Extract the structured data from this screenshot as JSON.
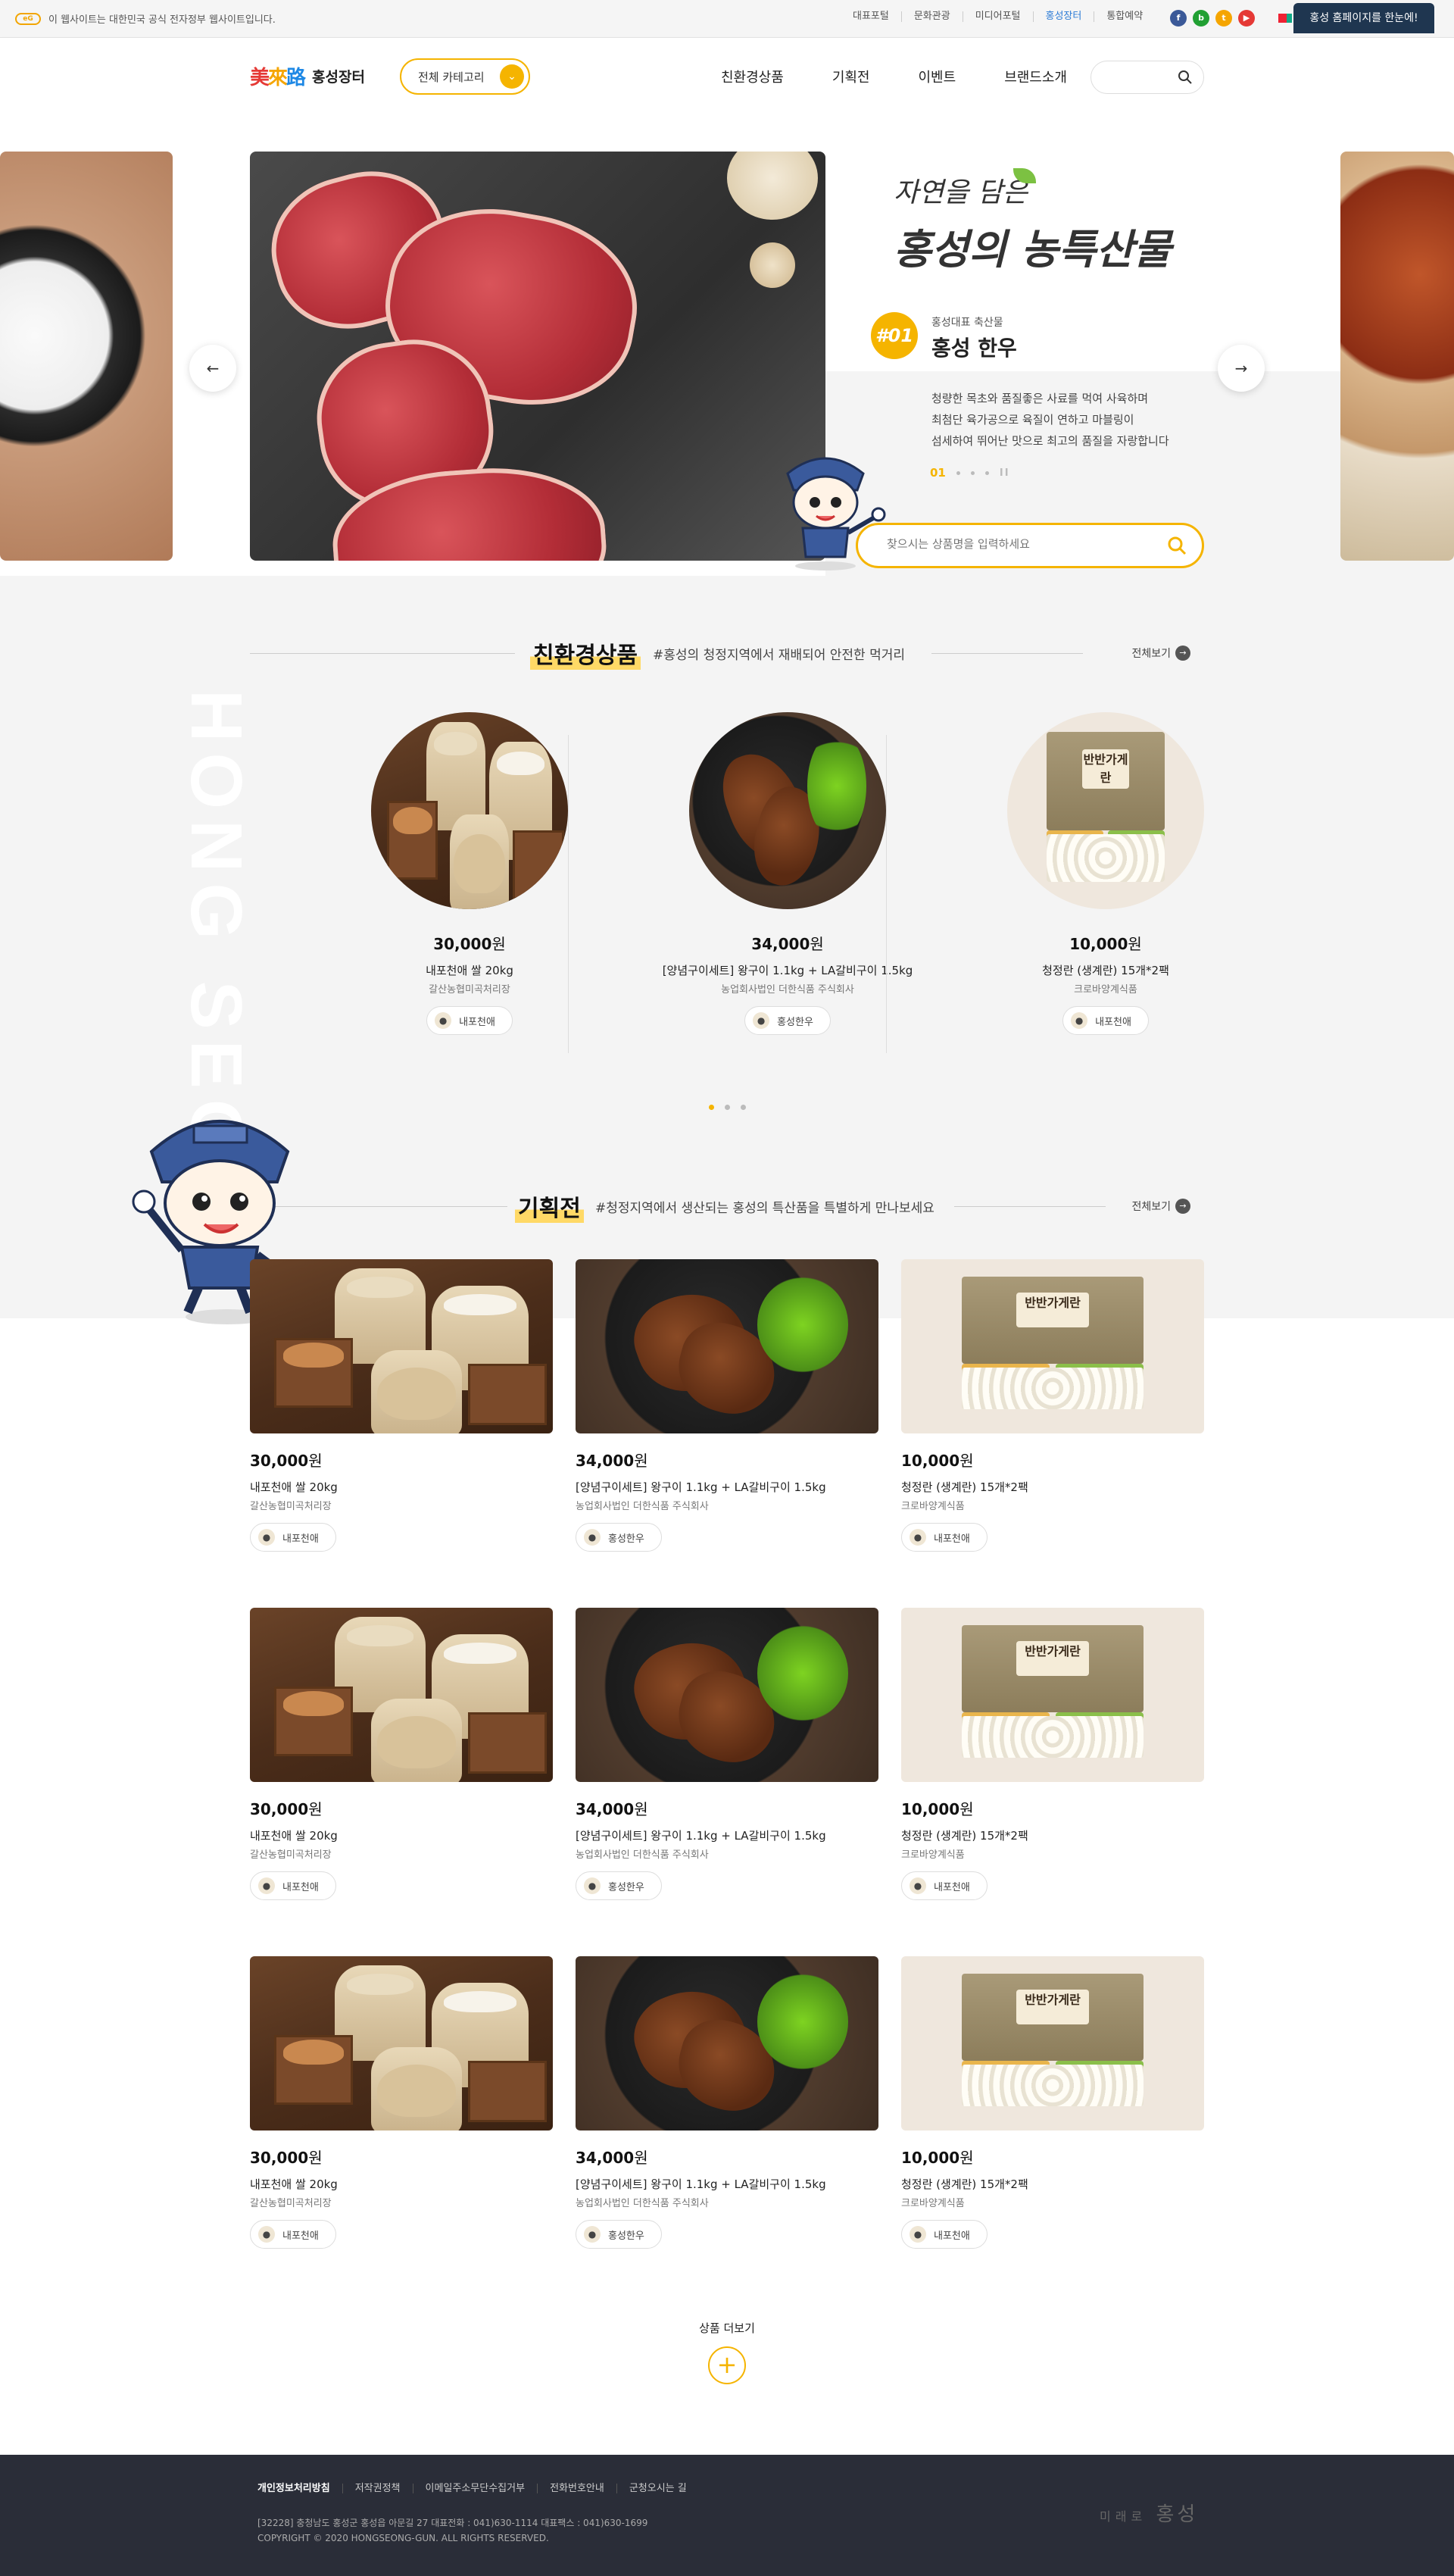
{
  "topbar": {
    "notice": "이 웹사이트는 대한민국 공식 전자정부 웹사이트입니다.",
    "eg_logo": "eG",
    "links": [
      "대표포털",
      "문화관광",
      "미디어포털",
      "홍성장터",
      "통합예약"
    ],
    "active_link": "홍성장터",
    "sns": [
      {
        "icon": "facebook-icon",
        "glyph": "f",
        "color": "#3b5998"
      },
      {
        "icon": "blog-icon",
        "glyph": "b",
        "color": "#21a033"
      },
      {
        "icon": "talk-icon",
        "glyph": "t",
        "color": "#f5a500"
      },
      {
        "icon": "youtube-icon",
        "glyph": "▶",
        "color": "#e53935"
      }
    ],
    "home_button": "홍성 홈페이지를 한눈에!"
  },
  "header": {
    "logo_mark": [
      "美",
      "來",
      "路"
    ],
    "logo_name": "홍성장터",
    "category_button": "전체 카테고리",
    "nav": [
      "친환경상품",
      "기획전",
      "이벤트",
      "브랜드소개"
    ],
    "search_placeholder": ""
  },
  "hero": {
    "slogan_line1": "자연을 담은",
    "slogan_line2": "홍성의 농특산물",
    "number": "#01",
    "category": "홍성대표 축산물",
    "title": "홍성 한우",
    "desc_lines": [
      "청량한 목초와 품질좋은 사료를 먹여 사육하며",
      "최첨단 육가공으로 육질이 연하고 마블링이",
      "섬세하여 뛰어난 맛으로 최고의 품질을 자랑합니다"
    ],
    "page_current": "01",
    "pause_icon": "II",
    "prev_icon": "←",
    "next_icon": "→",
    "search_placeholder": "찾으시는 상품명을 입력하세요"
  },
  "eco": {
    "title": "친환경상품",
    "subtitle": "#홍성의 청정지역에서 재배되어 안전한 먹거리",
    "more": "전체보기",
    "vertical_text": "HONG SEONG",
    "items": [
      {
        "price": "30,000",
        "won": "원",
        "name": "내포천애 쌀 20kg",
        "seller": "갈산농협미곡처리장",
        "tag": "내포천애",
        "art": "rice"
      },
      {
        "price": "34,000",
        "won": "원",
        "name": "[양념구이세트] 왕구이 1.1kg + LA갈비구이 1.5kg",
        "seller": "농업회사법인 더한식품 주식회사",
        "tag": "홍성한우",
        "art": "rib"
      },
      {
        "price": "10,000",
        "won": "원",
        "name": "청정란 (생계란) 15개*2팩",
        "seller": "크로바양계식품",
        "tag": "내포천애",
        "art": "egg"
      }
    ],
    "page_dots": 3,
    "active_dot": 0
  },
  "plan": {
    "title": "기획전",
    "subtitle": "#청정지역에서 생산되는 홍성의 특산품을 특별하게 만나보세요",
    "more": "전체보기",
    "rows": [
      [
        {
          "price": "30,000",
          "won": "원",
          "name": "내포천애 쌀 20kg",
          "seller": "갈산농협미곡처리장",
          "tag": "내포천애",
          "art": "rice"
        },
        {
          "price": "34,000",
          "won": "원",
          "name": "[양념구이세트] 왕구이 1.1kg + LA갈비구이 1.5kg",
          "seller": "농업회사법인 더한식품 주식회사",
          "tag": "홍성한우",
          "art": "rib"
        },
        {
          "price": "10,000",
          "won": "원",
          "name": "청정란 (생계란) 15개*2팩",
          "seller": "크로바양계식품",
          "tag": "내포천애",
          "art": "egg"
        }
      ],
      [
        {
          "price": "30,000",
          "won": "원",
          "name": "내포천애 쌀 20kg",
          "seller": "갈산농협미곡처리장",
          "tag": "내포천애",
          "art": "rice"
        },
        {
          "price": "34,000",
          "won": "원",
          "name": "[양념구이세트] 왕구이 1.1kg + LA갈비구이 1.5kg",
          "seller": "농업회사법인 더한식품 주식회사",
          "tag": "홍성한우",
          "art": "rib"
        },
        {
          "price": "10,000",
          "won": "원",
          "name": "청정란 (생계란) 15개*2팩",
          "seller": "크로바양계식품",
          "tag": "내포천애",
          "art": "egg"
        }
      ],
      [
        {
          "price": "30,000",
          "won": "원",
          "name": "내포천애 쌀 20kg",
          "seller": "갈산농협미곡처리장",
          "tag": "내포천애",
          "art": "rice"
        },
        {
          "price": "34,000",
          "won": "원",
          "name": "[양념구이세트] 왕구이 1.1kg + LA갈비구이 1.5kg",
          "seller": "농업회사법인 더한식품 주식회사",
          "tag": "홍성한우",
          "art": "rib"
        },
        {
          "price": "10,000",
          "won": "원",
          "name": "청정란 (생계란) 15개*2팩",
          "seller": "크로바양계식품",
          "tag": "내포천애",
          "art": "egg"
        }
      ]
    ],
    "more_button": "상품 더보기",
    "plus_icon": "+"
  },
  "egg_label": "반반가게란",
  "footer": {
    "links": [
      "개인정보처리방침",
      "저작권정책",
      "이메일주소무단수집거부",
      "전화번호안내",
      "군청오시는 길"
    ],
    "address": "[32228] 충청남도 홍성군 홍성읍 아문길 27 대표전화 : 041)630-1114 대표팩스 : 041)630-1699",
    "copyright": "COPYRIGHT © 2020 HONGSEONG-GUN. ALL RIGHTS RESERVED.",
    "logo_small": "미래로",
    "logo_big": "홍성"
  },
  "colors": {
    "accent": "#f5b400",
    "footer_bg": "#2a2d38",
    "home_btn": "#1f3650",
    "active_link": "#2d7cd6"
  }
}
